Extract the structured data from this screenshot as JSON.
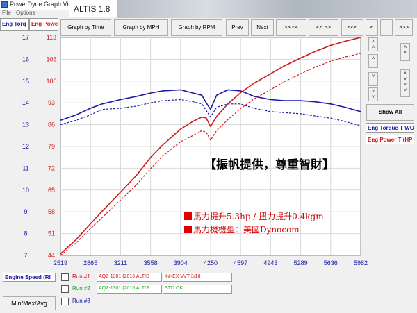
{
  "window": {
    "title": "PowerDyne Graph Viewer",
    "overlay_title": "ALTIS 1.8"
  },
  "menu": [
    "File",
    "Options"
  ],
  "axes": {
    "torque_header": "Eng Torq",
    "power_header": "Eng Powe",
    "torque_ticks": [
      "17",
      "16",
      "15",
      "14",
      "13",
      "12",
      "11",
      "10",
      "9",
      "8",
      "7"
    ],
    "power_ticks": [
      "113",
      "106",
      "100",
      "93",
      "86",
      "79",
      "72",
      "65",
      "58",
      "51",
      "44"
    ],
    "x_ticks": [
      "2519",
      "2865",
      "3211",
      "3558",
      "3904",
      "4250",
      "4597",
      "4943",
      "5289",
      "5636",
      "5982"
    ],
    "colors": {
      "torque": "#1a1aa6",
      "power": "#cc1a1a"
    }
  },
  "toolbar": {
    "time": "Graph by Time",
    "mph": "Graph by MPH",
    "rpm": "Graph by RPM",
    "prev": "Prev",
    "next": "Next",
    "b1": ">> <<",
    "b2": "<< >>",
    "b3": "<<<",
    "b4": "<",
    ">": ">",
    "b6": ">>>"
  },
  "side": {
    "show_all": "Show All",
    "legend_torque": "Eng Torque T WO",
    "legend_power": "Eng Power T (HP"
  },
  "annotations": {
    "watermark": "【振帆提供，尊重智財】",
    "line1": "馬力提升5.3hp / 扭力提升0.4kgm",
    "line2": "馬力機機型：美國Dynocom"
  },
  "bottom": {
    "xaxis_label": "Engine Speed (RI",
    "runs": [
      {
        "label": "Run #1",
        "name": "AQZ-1301 (2016 ALTIS",
        "note": "IN+EX VVT  3/18",
        "color": "#cc1a1a"
      },
      {
        "label": "Run #2",
        "name": "AQZ-1301 (2016 ALTIS",
        "note": "STD OK",
        "color": "#2aa52a"
      },
      {
        "label": "Run #3",
        "name": "",
        "note": "",
        "color": "#1a1aa6"
      }
    ],
    "minmax": "Min/Max/Avg"
  },
  "chart_data": {
    "type": "line",
    "xlabel": "Engine Speed (RI",
    "xlim": [
      2519,
      5982
    ],
    "y_left": {
      "label": "Eng Torq",
      "range": [
        7,
        17
      ]
    },
    "y_right": {
      "label": "Eng Powe",
      "range": [
        44,
        113
      ]
    },
    "grid": true,
    "series": [
      {
        "name": "Eng Torque T WO",
        "axis": "left",
        "style": "solid",
        "color": "#1a1aa6",
        "x": [
          2519,
          2700,
          2865,
          3000,
          3211,
          3400,
          3558,
          3700,
          3904,
          4050,
          4150,
          4200,
          4250,
          4320,
          4450,
          4597,
          4750,
          4943,
          5100,
          5289,
          5450,
          5636,
          5800,
          5982
        ],
        "y": [
          13.2,
          13.45,
          13.75,
          13.95,
          14.15,
          14.3,
          14.45,
          14.55,
          14.6,
          14.45,
          14.35,
          14.0,
          13.7,
          14.35,
          14.6,
          14.55,
          14.3,
          14.15,
          14.1,
          14.1,
          14.05,
          13.95,
          13.8,
          13.6
        ]
      },
      {
        "name": "Eng Torque T WO",
        "axis": "left",
        "style": "dashed",
        "color": "#1a1aa6",
        "x": [
          2519,
          2700,
          2865,
          3000,
          3211,
          3400,
          3558,
          3700,
          3904,
          4050,
          4150,
          4200,
          4250,
          4320,
          4450,
          4597,
          4750,
          4943,
          5100,
          5289,
          5450,
          5636,
          5800,
          5982
        ],
        "y": [
          13.0,
          13.2,
          13.45,
          13.7,
          13.75,
          13.85,
          14.0,
          14.1,
          14.15,
          14.05,
          13.95,
          13.65,
          13.35,
          13.8,
          13.95,
          13.95,
          13.75,
          13.6,
          13.55,
          13.5,
          13.4,
          13.3,
          13.15,
          12.95
        ]
      },
      {
        "name": "Eng Power T (HP",
        "axis": "right",
        "style": "solid",
        "color": "#cc1a1a",
        "x": [
          2519,
          2700,
          2865,
          3000,
          3211,
          3400,
          3558,
          3700,
          3904,
          4050,
          4150,
          4200,
          4250,
          4320,
          4450,
          4597,
          4750,
          4943,
          5100,
          5289,
          5450,
          5636,
          5800,
          5982
        ],
        "y": [
          44.5,
          49,
          54,
          58,
          64,
          69.5,
          75,
          79,
          84,
          86.5,
          87.8,
          87.5,
          84.8,
          88,
          92,
          95.5,
          98.5,
          101.5,
          104,
          106.5,
          108.5,
          110.5,
          111.8,
          113
        ]
      },
      {
        "name": "Eng Power T (HP",
        "axis": "right",
        "style": "dashed",
        "color": "#cc1a1a",
        "x": [
          2519,
          2700,
          2865,
          3000,
          3211,
          3400,
          3558,
          3700,
          3904,
          4050,
          4150,
          4200,
          4250,
          4320,
          4450,
          4597,
          4750,
          4943,
          5100,
          5289,
          5450,
          5636,
          5800,
          5982
        ],
        "y": [
          44,
          48,
          52.5,
          56,
          61.5,
          66.5,
          71.5,
          75.5,
          80,
          82,
          83.5,
          83,
          80.5,
          83.5,
          87,
          90.5,
          93.5,
          96.5,
          99,
          101.5,
          103.5,
          105.5,
          106.8,
          108
        ]
      }
    ]
  }
}
